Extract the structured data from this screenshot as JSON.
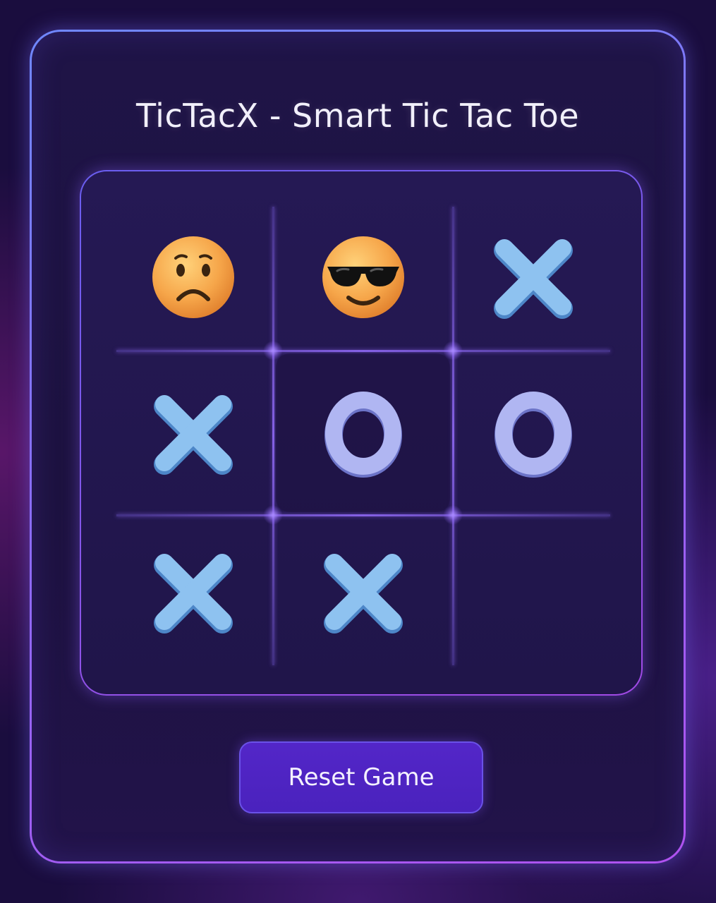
{
  "app": {
    "title": "TicTacX - Smart Tic Tac Toe"
  },
  "board": {
    "cells": [
      "sad-emoji",
      "cool-emoji",
      "X",
      "X",
      "O",
      "O",
      "X",
      "X",
      ""
    ]
  },
  "controls": {
    "reset_label": "Reset Game"
  },
  "colors": {
    "x_mark": "#8ec2f0",
    "o_mark": "#b0b6f2",
    "accent": "#4e24c2",
    "emoji_face": "#f6a64a"
  }
}
